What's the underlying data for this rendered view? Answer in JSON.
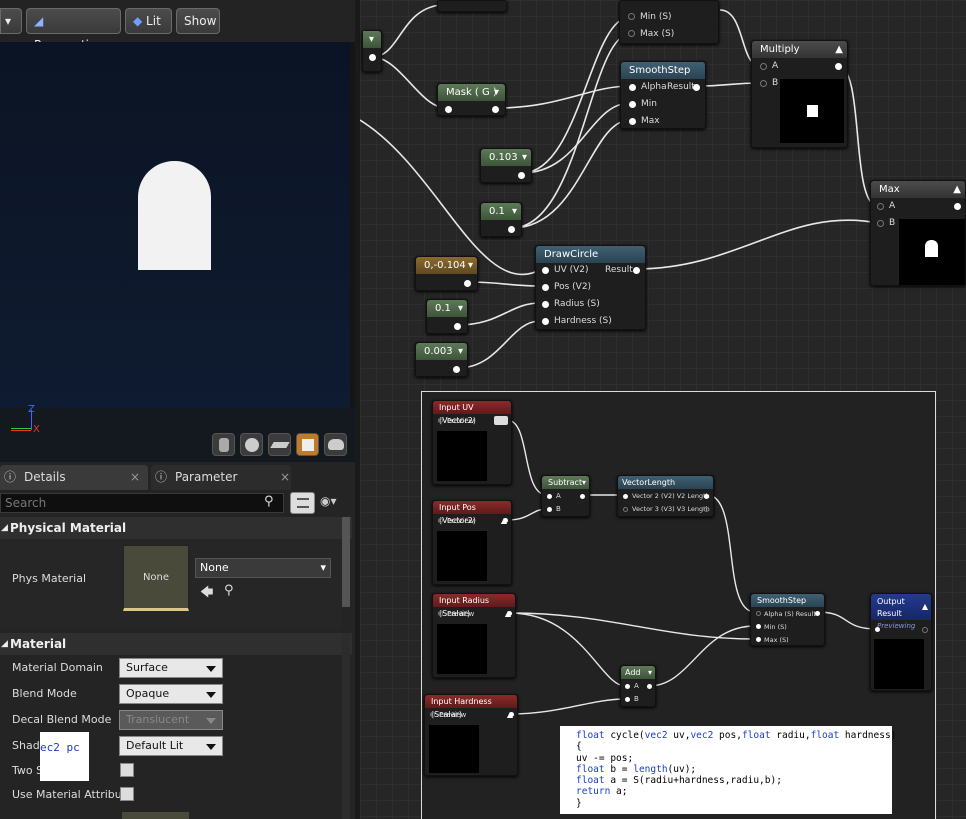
{
  "viewport": {
    "perspective_label": "Perspective",
    "lit_label": "Lit",
    "show_label": "Show",
    "axis_z": "Z",
    "axis_x": "X"
  },
  "details": {
    "tab_details": "Details",
    "tab_params": "Parameter Defaults",
    "search_placeholder": "Search",
    "section_physical": "Physical Material",
    "phys_material_label": "Phys Material",
    "phys_thumb_text": "None",
    "phys_dropdown": "None",
    "section_material": "Material",
    "rows": [
      {
        "label": "Material Domain",
        "value": "Surface"
      },
      {
        "label": "Blend Mode",
        "value": "Opaque"
      },
      {
        "label": "Decal Blend Mode",
        "value": "Translucent"
      },
      {
        "label": "Shadi",
        "value": "Default Lit"
      },
      {
        "label": "Two S",
        "value": ""
      },
      {
        "label": "Use Material Attribut",
        "value": ""
      }
    ],
    "snippet_text": "ec2 pc"
  },
  "graph": {
    "minmax_min": "Min (S)",
    "minmax_max": "Max (S)",
    "mask_title": "Mask ( G )",
    "smoothstep_title": "SmoothStep",
    "smoothstep_alpha": "Alpha",
    "smoothstep_result": "Result",
    "smoothstep_min": "Min",
    "smoothstep_max": "Max",
    "multiply_title": "Multiply",
    "mult_a": "A",
    "mult_b": "B",
    "const_0103": "0.103",
    "const_01a": "0.1",
    "max_title": "Max",
    "max_a": "A",
    "max_b": "B",
    "const_vec": "0,-0.104",
    "drawcircle_title": "DrawCircle",
    "dc_uv": "UV (V2)",
    "dc_result": "Result",
    "dc_pos": "Pos (V2)",
    "dc_radius": "Radius (S)",
    "dc_hardness": "Hardness (S)",
    "const_01b": "0.1",
    "const_0003": "0.003"
  },
  "inset": {
    "in_uv": "Input UV (Vector2)",
    "in_pos": "Input Pos (Vector2)",
    "in_radius": "Input Radius (Scalar)",
    "in_hardness": "Input Hardness (Scalar)",
    "preview": "Preview",
    "subtract": "Subtract",
    "sub_a": "A",
    "sub_b": "B",
    "veclen": "VectorLength",
    "veclen_v2": "Vector 2 (V2) V2 Length",
    "veclen_v3": "Vector 3 (V3) V3 Length",
    "smooth": "SmoothStep",
    "smooth_alpha": "Alpha (S) Result",
    "smooth_min": "Min (S)",
    "smooth_max": "Max (S)",
    "add": "Add",
    "add_a": "A",
    "add_b": "B",
    "output": "Output Result",
    "previewing": "Previewing"
  },
  "code": {
    "line1_kw1": "float",
    "line1_a": " cycle(",
    "line1_kw2": "vec2",
    "line1_b": " uv,",
    "line1_kw3": "vec2",
    "line1_c": " pos,",
    "line1_kw4": "float",
    "line1_d": " radiu,",
    "line1_kw5": "float",
    "line1_e": " hardness)",
    "line2": "{",
    "line3": "uv -= pos;",
    "line4_kw": "float",
    "line4_a": " b = ",
    "line4_kw2": "length",
    "line4_b": "(uv);",
    "line5_kw": "float",
    "line5_a": " a = S(radiu+hardness,radiu,b);",
    "line6_kw": "return",
    "line6_a": " a;",
    "line7": "}"
  }
}
